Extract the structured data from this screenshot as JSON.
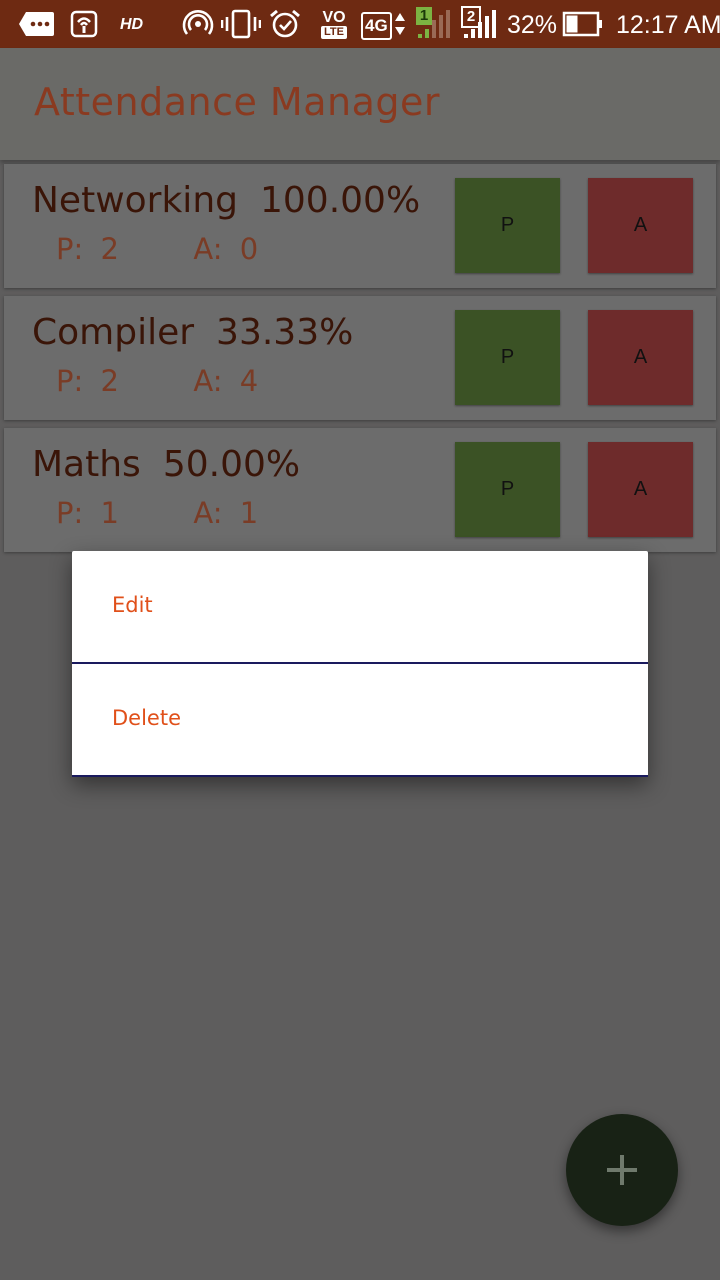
{
  "status_bar": {
    "hd_label": "HD",
    "volte_top": "VO",
    "volte_bottom": "LTE",
    "network_type": "4G",
    "sim1_label": "1",
    "sim2_label": "2",
    "battery_percent": "32%",
    "time": "12:17 AM",
    "icons": [
      "chat-icon",
      "wifi-calling-icon",
      "hotspot-icon",
      "vibrate-icon",
      "alarm-icon",
      "data-arrows-icon",
      "signal-icon",
      "battery-icon"
    ],
    "color": "#6e2a12"
  },
  "app_bar": {
    "title": "Attendance Manager",
    "title_color": "#8a3a20"
  },
  "subjects": [
    {
      "name": "Networking",
      "percent": "100.00%",
      "p_label": "P:",
      "p_value": "2",
      "a_label": "A:",
      "a_value": "0",
      "present_btn": "P",
      "absent_btn": "A"
    },
    {
      "name": "Compiler",
      "percent": "33.33%",
      "p_label": "P:",
      "p_value": "2",
      "a_label": "A:",
      "a_value": "4",
      "present_btn": "P",
      "absent_btn": "A"
    },
    {
      "name": "Maths",
      "percent": "50.00%",
      "p_label": "P:",
      "p_value": "1",
      "a_label": "A:",
      "a_value": "1",
      "present_btn": "P",
      "absent_btn": "A"
    }
  ],
  "context_menu": {
    "items": [
      {
        "label": "Edit"
      },
      {
        "label": "Delete"
      }
    ],
    "accent_color": "#e0501a"
  },
  "fab": {
    "icon": "plus-icon",
    "color": "#182215"
  },
  "colors": {
    "present": "#3b5225",
    "absent": "#6e2b2b",
    "scrim": "#5e5d5d"
  }
}
